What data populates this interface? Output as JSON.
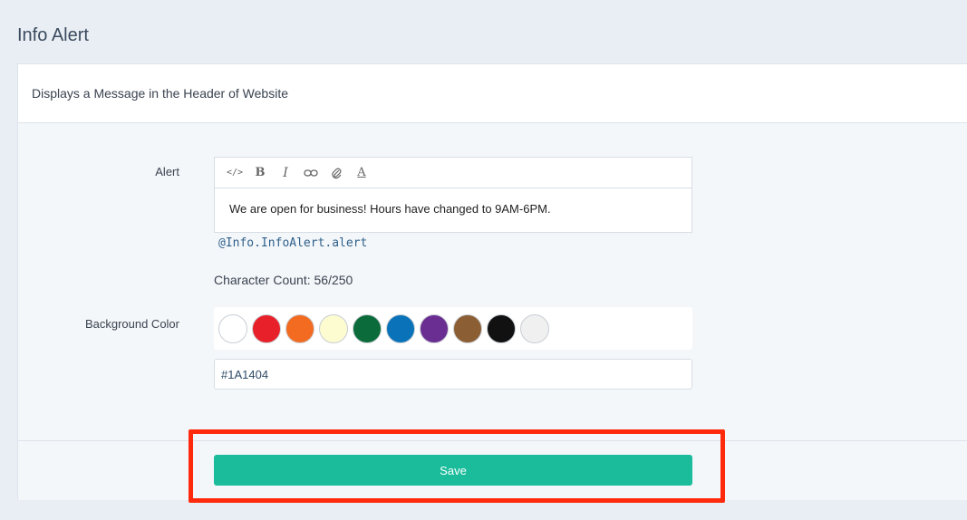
{
  "page": {
    "title": "Info Alert"
  },
  "panel": {
    "description": "Displays a Message in the Header of Website"
  },
  "alert_field": {
    "label": "Alert",
    "toolbar": [
      {
        "icon": "code-icon",
        "glyph": "</>"
      },
      {
        "icon": "bold-icon",
        "glyph": "B"
      },
      {
        "icon": "italic-icon",
        "glyph": "I"
      },
      {
        "icon": "link-icon",
        "glyph": "⊂⊃"
      },
      {
        "icon": "attachment-icon",
        "glyph": "📎"
      },
      {
        "icon": "text-color-icon",
        "glyph": "A"
      }
    ],
    "content": "We are open for business! Hours have changed to 9AM-6PM.",
    "merge_tag": "@Info.InfoAlert.alert",
    "character_count": "Character Count: 56/250"
  },
  "background_color": {
    "label": "Background Color",
    "swatches": [
      "#ffffff",
      "#e8202a",
      "#f26b21",
      "#fdfbd0",
      "#0b6b3a",
      "#0a72b8",
      "#6a2d92",
      "#8b5e34",
      "#111111",
      "#f0f0f0"
    ],
    "value": "#1A1404"
  },
  "footer": {
    "save_label": "Save"
  },
  "colors": {
    "accent": "#1abc9c",
    "highlight": "#ff2a0c"
  }
}
